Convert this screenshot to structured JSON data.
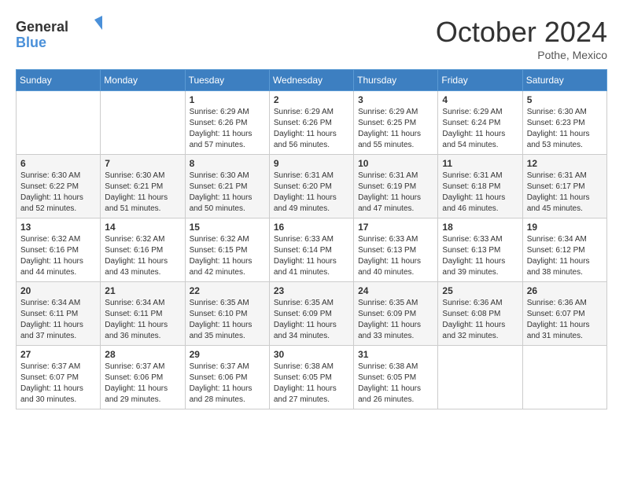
{
  "header": {
    "logo_line1": "General",
    "logo_line2": "Blue",
    "month_title": "October 2024",
    "subtitle": "Pothe, Mexico"
  },
  "days_of_week": [
    "Sunday",
    "Monday",
    "Tuesday",
    "Wednesday",
    "Thursday",
    "Friday",
    "Saturday"
  ],
  "weeks": [
    [
      {
        "day": "",
        "info": ""
      },
      {
        "day": "",
        "info": ""
      },
      {
        "day": "1",
        "sunrise": "Sunrise: 6:29 AM",
        "sunset": "Sunset: 6:26 PM",
        "daylight": "Daylight: 11 hours and 57 minutes."
      },
      {
        "day": "2",
        "sunrise": "Sunrise: 6:29 AM",
        "sunset": "Sunset: 6:26 PM",
        "daylight": "Daylight: 11 hours and 56 minutes."
      },
      {
        "day": "3",
        "sunrise": "Sunrise: 6:29 AM",
        "sunset": "Sunset: 6:25 PM",
        "daylight": "Daylight: 11 hours and 55 minutes."
      },
      {
        "day": "4",
        "sunrise": "Sunrise: 6:29 AM",
        "sunset": "Sunset: 6:24 PM",
        "daylight": "Daylight: 11 hours and 54 minutes."
      },
      {
        "day": "5",
        "sunrise": "Sunrise: 6:30 AM",
        "sunset": "Sunset: 6:23 PM",
        "daylight": "Daylight: 11 hours and 53 minutes."
      }
    ],
    [
      {
        "day": "6",
        "sunrise": "Sunrise: 6:30 AM",
        "sunset": "Sunset: 6:22 PM",
        "daylight": "Daylight: 11 hours and 52 minutes."
      },
      {
        "day": "7",
        "sunrise": "Sunrise: 6:30 AM",
        "sunset": "Sunset: 6:21 PM",
        "daylight": "Daylight: 11 hours and 51 minutes."
      },
      {
        "day": "8",
        "sunrise": "Sunrise: 6:30 AM",
        "sunset": "Sunset: 6:21 PM",
        "daylight": "Daylight: 11 hours and 50 minutes."
      },
      {
        "day": "9",
        "sunrise": "Sunrise: 6:31 AM",
        "sunset": "Sunset: 6:20 PM",
        "daylight": "Daylight: 11 hours and 49 minutes."
      },
      {
        "day": "10",
        "sunrise": "Sunrise: 6:31 AM",
        "sunset": "Sunset: 6:19 PM",
        "daylight": "Daylight: 11 hours and 47 minutes."
      },
      {
        "day": "11",
        "sunrise": "Sunrise: 6:31 AM",
        "sunset": "Sunset: 6:18 PM",
        "daylight": "Daylight: 11 hours and 46 minutes."
      },
      {
        "day": "12",
        "sunrise": "Sunrise: 6:31 AM",
        "sunset": "Sunset: 6:17 PM",
        "daylight": "Daylight: 11 hours and 45 minutes."
      }
    ],
    [
      {
        "day": "13",
        "sunrise": "Sunrise: 6:32 AM",
        "sunset": "Sunset: 6:16 PM",
        "daylight": "Daylight: 11 hours and 44 minutes."
      },
      {
        "day": "14",
        "sunrise": "Sunrise: 6:32 AM",
        "sunset": "Sunset: 6:16 PM",
        "daylight": "Daylight: 11 hours and 43 minutes."
      },
      {
        "day": "15",
        "sunrise": "Sunrise: 6:32 AM",
        "sunset": "Sunset: 6:15 PM",
        "daylight": "Daylight: 11 hours and 42 minutes."
      },
      {
        "day": "16",
        "sunrise": "Sunrise: 6:33 AM",
        "sunset": "Sunset: 6:14 PM",
        "daylight": "Daylight: 11 hours and 41 minutes."
      },
      {
        "day": "17",
        "sunrise": "Sunrise: 6:33 AM",
        "sunset": "Sunset: 6:13 PM",
        "daylight": "Daylight: 11 hours and 40 minutes."
      },
      {
        "day": "18",
        "sunrise": "Sunrise: 6:33 AM",
        "sunset": "Sunset: 6:13 PM",
        "daylight": "Daylight: 11 hours and 39 minutes."
      },
      {
        "day": "19",
        "sunrise": "Sunrise: 6:34 AM",
        "sunset": "Sunset: 6:12 PM",
        "daylight": "Daylight: 11 hours and 38 minutes."
      }
    ],
    [
      {
        "day": "20",
        "sunrise": "Sunrise: 6:34 AM",
        "sunset": "Sunset: 6:11 PM",
        "daylight": "Daylight: 11 hours and 37 minutes."
      },
      {
        "day": "21",
        "sunrise": "Sunrise: 6:34 AM",
        "sunset": "Sunset: 6:11 PM",
        "daylight": "Daylight: 11 hours and 36 minutes."
      },
      {
        "day": "22",
        "sunrise": "Sunrise: 6:35 AM",
        "sunset": "Sunset: 6:10 PM",
        "daylight": "Daylight: 11 hours and 35 minutes."
      },
      {
        "day": "23",
        "sunrise": "Sunrise: 6:35 AM",
        "sunset": "Sunset: 6:09 PM",
        "daylight": "Daylight: 11 hours and 34 minutes."
      },
      {
        "day": "24",
        "sunrise": "Sunrise: 6:35 AM",
        "sunset": "Sunset: 6:09 PM",
        "daylight": "Daylight: 11 hours and 33 minutes."
      },
      {
        "day": "25",
        "sunrise": "Sunrise: 6:36 AM",
        "sunset": "Sunset: 6:08 PM",
        "daylight": "Daylight: 11 hours and 32 minutes."
      },
      {
        "day": "26",
        "sunrise": "Sunrise: 6:36 AM",
        "sunset": "Sunset: 6:07 PM",
        "daylight": "Daylight: 11 hours and 31 minutes."
      }
    ],
    [
      {
        "day": "27",
        "sunrise": "Sunrise: 6:37 AM",
        "sunset": "Sunset: 6:07 PM",
        "daylight": "Daylight: 11 hours and 30 minutes."
      },
      {
        "day": "28",
        "sunrise": "Sunrise: 6:37 AM",
        "sunset": "Sunset: 6:06 PM",
        "daylight": "Daylight: 11 hours and 29 minutes."
      },
      {
        "day": "29",
        "sunrise": "Sunrise: 6:37 AM",
        "sunset": "Sunset: 6:06 PM",
        "daylight": "Daylight: 11 hours and 28 minutes."
      },
      {
        "day": "30",
        "sunrise": "Sunrise: 6:38 AM",
        "sunset": "Sunset: 6:05 PM",
        "daylight": "Daylight: 11 hours and 27 minutes."
      },
      {
        "day": "31",
        "sunrise": "Sunrise: 6:38 AM",
        "sunset": "Sunset: 6:05 PM",
        "daylight": "Daylight: 11 hours and 26 minutes."
      },
      {
        "day": "",
        "info": ""
      },
      {
        "day": "",
        "info": ""
      }
    ]
  ]
}
